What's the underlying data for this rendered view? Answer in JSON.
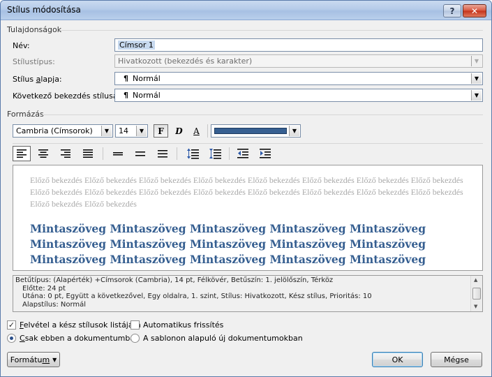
{
  "window": {
    "title": "Stílus módosítása",
    "help_label": "?",
    "close_label": "✕"
  },
  "properties": {
    "group_label": "Tulajdonságok",
    "name": {
      "label": "Név:",
      "value": "Címsor 1"
    },
    "style_type": {
      "label": "Stílustípus:",
      "value": "Hivatkozott (bekezdés és karakter)"
    },
    "based_on": {
      "label": "Stílus alapja:",
      "value": "Normál",
      "icon": "pilcrow-icon"
    },
    "next_style": {
      "label": "Következő bekezdés stílusa:",
      "value": "Normál",
      "icon": "pilcrow-icon"
    }
  },
  "formatting": {
    "group_label": "Formázás",
    "font": "Cambria (Címsorok)",
    "size": "14",
    "bold_label": "F",
    "italic_label": "D",
    "underline_label": "A",
    "color": "#365f91"
  },
  "preview": {
    "previous_paragraph": "Előző bekezdés Előző bekezdés Előző bekezdés Előző bekezdés Előző bekezdés Előző bekezdés Előző bekezdés Előző bekezdés Előző bekezdés Előző bekezdés Előző bekezdés Előző bekezdés Előző bekezdés Előző bekezdés Előző bekezdés Előző bekezdés Előző bekezdés Előző bekezdés",
    "sample_lines": [
      "Mintaszöveg Mintaszöveg Mintaszöveg Mintaszöveg Mintaszöveg",
      "Mintaszöveg Mintaszöveg Mintaszöveg Mintaszöveg Mintaszöveg",
      "Mintaszöveg Mintaszöveg Mintaszöveg Mintaszöveg Mintaszöveg"
    ]
  },
  "description": {
    "lines": [
      "Betűtípus: (Alapérték) +Címsorok (Cambria), 14 pt, Félkövér, Betűszín: 1. jelölőszín, Térköz",
      "Előtte:  24 pt",
      "Utána:  0 pt, Együtt a következővel, Egy oldalra, 1. szint, Stílus: Hivatkozott, Kész stílus, Prioritás: 10",
      "Alapstílus: Normál"
    ]
  },
  "options": {
    "add_to_quick": {
      "label": "Felvétel a kész stílusok listájára",
      "checked": true
    },
    "auto_update": {
      "label": "Automatikus frissítés",
      "checked": false
    },
    "only_this_doc": {
      "label": "Csak ebben a dokumentumban",
      "selected": true
    },
    "new_docs": {
      "label": "A sablonon alapuló új dokumentumokban",
      "selected": false
    }
  },
  "buttons": {
    "format": "Formátum",
    "ok": "OK",
    "cancel": "Mégse"
  }
}
